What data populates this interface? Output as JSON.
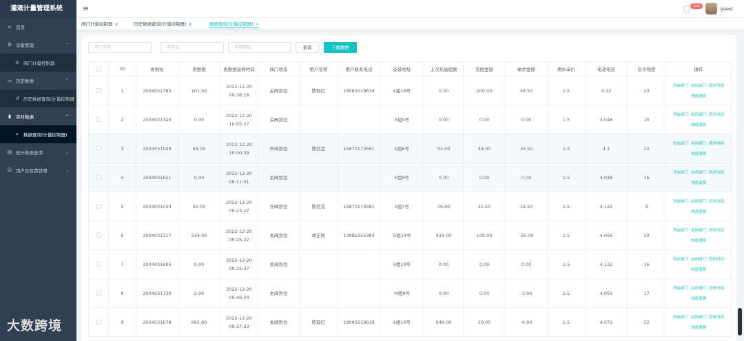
{
  "brand": "灌溉计量管理系统",
  "sidebar": {
    "items": [
      {
        "label": "首页",
        "icon": "home-icon"
      },
      {
        "label": "设备管理",
        "icon": "gear-icon",
        "arrow": "⌃"
      },
      {
        "label": "阀门计量控制器",
        "icon": "valve-icon",
        "sub": true
      },
      {
        "label": "历史数据",
        "icon": "folder-icon",
        "arrow": "⌃"
      },
      {
        "label": "历史数据查询(计量控制器",
        "icon": "history-icon",
        "sub": true
      },
      {
        "label": "实时数据",
        "icon": "chart-icon",
        "arrow": "⌃",
        "active": true
      },
      {
        "label": "数据查询(计量控制器)",
        "icon": "search-icon",
        "sub": true,
        "active": true
      },
      {
        "label": "统计数据查询",
        "icon": "stats-icon",
        "arrow": "⌄"
      },
      {
        "label": "用户及收费管理",
        "icon": "user-icon",
        "arrow": "⌄"
      }
    ]
  },
  "navbar": {
    "badge": "new",
    "username": "guest"
  },
  "tabs": [
    {
      "label": "阀门计量控制器"
    },
    {
      "label": "历史数据查询(计量控制器)"
    },
    {
      "label": "数据查询(计量控制器)",
      "active": true
    }
  ],
  "search": {
    "placeholders": [
      "用户名称",
      "表地址",
      "安装地址"
    ],
    "query_label": "查询",
    "download_label": "下载数据"
  },
  "table": {
    "headers": [
      "",
      "ID",
      "表地址",
      "表数据",
      "表数据接收时间",
      "阀门状态",
      "用户名称",
      "用户联系电话",
      "安装地址",
      "上次充值底数",
      "充值金额",
      "剩余金额",
      "用水单价",
      "电池电压",
      "信号强度",
      "操作"
    ],
    "actions": [
      "开启阀门",
      "关闭阀门",
      "同步时间",
      "充值退费"
    ],
    "rows": [
      {
        "id": "1",
        "addr": "2004031793",
        "data": "101.00",
        "time": "2022-12-20 09:38:18",
        "valve": "关阀到位",
        "user": "陈取红",
        "phone": "18083319619",
        "loc": "k组14号",
        "last": "0.00",
        "recharge": "200.00",
        "remain": "48.50",
        "price": "1.5",
        "voltage": "4.12",
        "signal": "23"
      },
      {
        "id": "2",
        "addr": "2004031343",
        "data": "0.00",
        "time": "2022-12-20 10:05:27",
        "valve": "关阀到位",
        "user": "",
        "phone": "",
        "loc": "E组9号",
        "last": "0.00",
        "recharge": "0.00",
        "remain": "0.00",
        "price": "1.5",
        "voltage": "4.048",
        "signal": "15"
      },
      {
        "id": "3",
        "addr": "2004031049",
        "data": "63.00",
        "time": "2022-12-20 10:00:39",
        "valve": "开阀到位",
        "user": "陈信堂",
        "phone": "15870173581",
        "loc": "k组6号",
        "last": "54.00",
        "recharge": "49.00",
        "remain": "35.50",
        "price": "1.5",
        "voltage": "4.1",
        "signal": "22"
      },
      {
        "id": "4",
        "addr": "2004031621",
        "data": "0.00",
        "time": "2022-12-20 09:11:01",
        "valve": "关阀到位",
        "user": "",
        "phone": "",
        "loc": "k组8号",
        "last": "0.00",
        "recharge": "0.00",
        "remain": "0.00",
        "price": "1.5",
        "voltage": "4.048",
        "signal": "16"
      },
      {
        "id": "5",
        "addr": "2004031034",
        "data": "91.00",
        "time": "2022-12-20 09:23:27",
        "valve": "开阀到位",
        "user": "陈信堂",
        "phone": "15870173581",
        "loc": "k组7号",
        "last": "79.00",
        "recharge": "31.50",
        "remain": "13.50",
        "price": "1.5",
        "voltage": "4.132",
        "signal": "9"
      },
      {
        "id": "6",
        "addr": "2004031317",
        "data": "534.00",
        "time": "2022-12-20 09:25:22",
        "valve": "关阀到位",
        "user": "胡正权",
        "phone": "13885355384",
        "loc": "G组14号",
        "last": "434.00",
        "recharge": "100.00",
        "remain": "-50.00",
        "price": "1.5",
        "voltage": "4.056",
        "signal": "20"
      },
      {
        "id": "7",
        "addr": "2004031606",
        "data": "0.00",
        "time": "2022-12-20 09:35:37",
        "valve": "关阀到位",
        "user": "",
        "phone": "",
        "loc": "k组10号",
        "last": "0.00",
        "recharge": "0.00",
        "remain": "0.00",
        "price": "1.5",
        "voltage": "4.132",
        "signal": "16"
      },
      {
        "id": "8",
        "addr": "2004031730",
        "data": "2.00",
        "time": "2022-12-20 09:46:34",
        "valve": "关阀到位",
        "user": "",
        "phone": "",
        "loc": "M组9号",
        "last": "0.00",
        "recharge": "0.00",
        "remain": "-3.00",
        "price": "1.5",
        "voltage": "4.056",
        "signal": "17"
      },
      {
        "id": "9",
        "addr": "2004031678",
        "data": "665.00",
        "time": "2022-12-20 09:57:33",
        "valve": "关阀到位",
        "user": "陈取红",
        "phone": "18083319619",
        "loc": "k组14号",
        "last": "649.00",
        "recharge": "20.00",
        "remain": "-4.00",
        "price": "1.5",
        "voltage": "4.072",
        "signal": "22"
      }
    ]
  },
  "watermark": "大数跨境"
}
